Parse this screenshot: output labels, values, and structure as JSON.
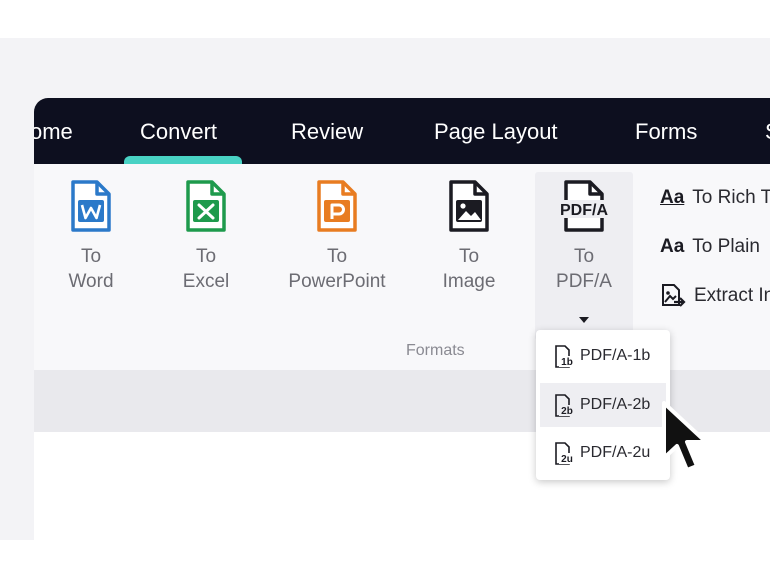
{
  "tabs": [
    {
      "label": "ome"
    },
    {
      "label": "Convert"
    },
    {
      "label": "Review"
    },
    {
      "label": "Page Layout"
    },
    {
      "label": "Forms"
    },
    {
      "label": "S"
    }
  ],
  "active_tab": "Convert",
  "colors": {
    "tab_bar": "#0d0f1f",
    "accent": "#49d2c4",
    "word": "#2b79c9",
    "excel": "#1e9a4c",
    "powerpoint": "#e87c21"
  },
  "ribbon": {
    "buttons": [
      {
        "line1": "To",
        "line2": "Word",
        "icon": "word-file-icon"
      },
      {
        "line1": "To",
        "line2": "Excel",
        "icon": "excel-file-icon"
      },
      {
        "line1": "To",
        "line2": "PowerPoint",
        "icon": "powerpoint-file-icon"
      },
      {
        "line1": "To",
        "line2": "Image",
        "icon": "image-file-icon"
      },
      {
        "line1": "To",
        "line2": "PDF/A",
        "icon": "pdfa-file-icon",
        "icon_text": "PDF/A"
      }
    ],
    "group_label": "Formats",
    "side_items": [
      {
        "aa": "Aa",
        "label": "To Rich T"
      },
      {
        "aa": "Aa",
        "label": "To Plain"
      },
      {
        "label": "Extract In"
      }
    ]
  },
  "dropdown": {
    "items": [
      {
        "label": "PDF/A-1b",
        "badge": "1b"
      },
      {
        "label": "PDF/A-2b",
        "badge": "2b"
      },
      {
        "label": "PDF/A-2u",
        "badge": "2u"
      }
    ],
    "hovered_index": 1
  }
}
